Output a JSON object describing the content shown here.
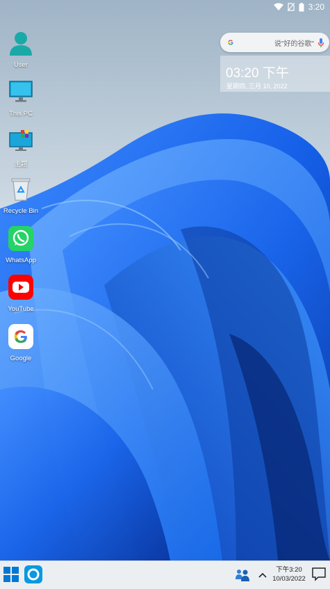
{
  "status_bar": {
    "time": "3:20"
  },
  "desktop_icons": [
    {
      "label": "User",
      "icon": "user-icon"
    },
    {
      "label": "This PC",
      "icon": "monitor-icon"
    },
    {
      "label": "主题",
      "icon": "theme-icon"
    },
    {
      "label": "Recycle Bin",
      "icon": "recycle-bin-icon"
    },
    {
      "label": "WhatsApp",
      "icon": "whatsapp-icon"
    },
    {
      "label": "YouTube",
      "icon": "youtube-icon"
    },
    {
      "label": "Google",
      "icon": "google-icon"
    }
  ],
  "search_widget": {
    "placeholder": "说\"好的谷歌\""
  },
  "clock_widget": {
    "time": "03:20 下午",
    "date": "星期四, 三月 10, 2022"
  },
  "taskbar": {
    "time": "下午3:20",
    "date": "10/03/2022"
  },
  "colors": {
    "wallpaper_blue": "#1a6ff0",
    "taskbar_bg": "#eceff2",
    "whatsapp": "#25d366",
    "youtube": "#ff0000"
  }
}
